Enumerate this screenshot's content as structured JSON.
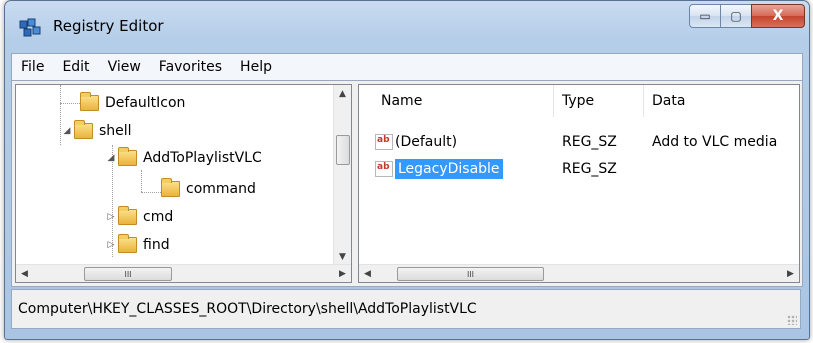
{
  "window": {
    "title": "Registry Editor"
  },
  "caption_buttons": {
    "minimize": "▭",
    "maximize": "▢",
    "close": "X"
  },
  "menu": [
    "File",
    "Edit",
    "View",
    "Favorites",
    "Help"
  ],
  "tree": {
    "items": [
      {
        "label": "DefaultIcon",
        "level": 1,
        "expander": ""
      },
      {
        "label": "shell",
        "level": 1,
        "expander": "◢"
      },
      {
        "label": "AddToPlaylistVLC",
        "level": 2,
        "expander": "◢"
      },
      {
        "label": "command",
        "level": 3,
        "expander": ""
      },
      {
        "label": "cmd",
        "level": 2,
        "expander": "▷"
      },
      {
        "label": "find",
        "level": 2,
        "expander": "▷"
      }
    ],
    "scroll_glyph": "III"
  },
  "list": {
    "columns": [
      "Name",
      "Type",
      "Data"
    ],
    "rows": [
      {
        "icon": "ab",
        "name": "(Default)",
        "type": "REG_SZ",
        "data": "Add to VLC media",
        "selected": false
      },
      {
        "icon": "ab",
        "name": "LegacyDisable",
        "type": "REG_SZ",
        "data": "",
        "selected": true
      }
    ],
    "scroll_glyph": "III"
  },
  "status": {
    "path": "Computer\\HKEY_CLASSES_ROOT\\Directory\\shell\\AddToPlaylistVLC"
  },
  "colors": {
    "selection": "#3399ff",
    "title_frame": "#b4cde8",
    "close_button": "#c4442d"
  }
}
